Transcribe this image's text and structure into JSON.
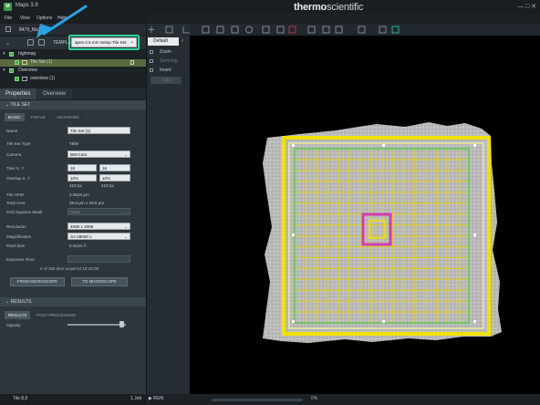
{
  "app": {
    "title": "Maps 3.9",
    "brand_bold": "thermo",
    "brand_light": "scientific",
    "window_controls": "—  □  ✕"
  },
  "menu": [
    "File",
    "View",
    "Options",
    "Help"
  ],
  "project": {
    "name": "8479_Nicolas"
  },
  "template": {
    "label": "TEMPLATE",
    "value": "apes 0.5 mm Setup Tile Set"
  },
  "tree": [
    {
      "label": "highmag"
    },
    {
      "label": "Tile Set (1)"
    },
    {
      "label": "Overview"
    },
    {
      "label": "overview (1)"
    }
  ],
  "tabs": {
    "properties": "Properties",
    "overview": "Overview"
  },
  "sections": {
    "tile_set": "TILE SET",
    "results": "RESULTS"
  },
  "subtabs": {
    "basic": "BASIC",
    "focus": "FOCUS",
    "advanced": "ADVANCED",
    "results": "RESULTS",
    "post_processing": "POST PROCESSING"
  },
  "props": {
    "name_label": "Name",
    "name_value": "Tile Set (1)",
    "type_label": "Tile Set Type",
    "type_value": "TEM",
    "camera_label": "Camera",
    "camera_value": "BM-Ceta",
    "tiles_label": "Tiles X, Y",
    "tiles_x": "16",
    "tiles_y": "16",
    "overlap_label": "Overlap X, Y",
    "overlap_x": "10%",
    "overlap_y": "10%",
    "overlap_px_x": "410 px",
    "overlap_px_y": "410 px",
    "hfw_label": "Tile HFW",
    "hfw_value": "2.0523 µm",
    "area_label": "Total Area",
    "area_value": "29.8 µm x 29.8 µm",
    "mask_label": "Grid Squares Mask",
    "mask_value": "None",
    "resolution_label": "Resolution",
    "resolution_value": "4096 x 4096",
    "magnification_label": "Magnification",
    "magnification_value": "SA 28000 x",
    "pixel_label": "Pixel Size",
    "pixel_value": "5.0104 Å",
    "exposure_label": "Exposure Time",
    "exposure_value": "",
    "acquired_text": "0 of 256 tiles acquired 19:42:08",
    "from_microscope": "FROM MICROSCOPE",
    "to_microscope": "TO MICROSCOPE",
    "opacity_label": "Opacity",
    "opacity_value": 0.97
  },
  "layers": {
    "default": "Default",
    "zoom": "Zoom",
    "sem_log": "Semi-log",
    "invert": "Invert",
    "auto": "Auto"
  },
  "status": {
    "tile": "Tile 8,9",
    "jobs": "1 Job",
    "run": "RUN",
    "zoom": "0%"
  },
  "grid": {
    "tiles": 16,
    "frame_color": "#f2e200",
    "tile_line_color": "#d8c93a",
    "outline_color": "#42c84a",
    "highlight_color": "#d23cb0",
    "annotation_color": "#2aa3e0"
  }
}
